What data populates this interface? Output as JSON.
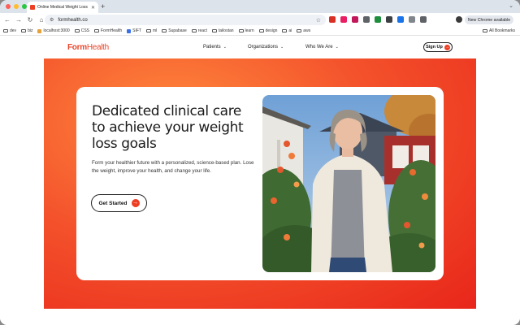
{
  "browser": {
    "tab_title": "Online Medical Weight Loss",
    "url": "formhealth.co",
    "profile_button": "New Chrome available",
    "bookmarks": [
      {
        "label": "dev",
        "type": "folder"
      },
      {
        "label": "biz",
        "type": "folder"
      },
      {
        "label": "localhost:3000",
        "type": "site",
        "color": "#e5a13a"
      },
      {
        "label": "CSS",
        "type": "folder"
      },
      {
        "label": "FormHealth",
        "type": "folder"
      },
      {
        "label": "SIFT",
        "type": "site",
        "color": "#3a6fe5"
      },
      {
        "label": "ml",
        "type": "folder"
      },
      {
        "label": "Supabase",
        "type": "folder"
      },
      {
        "label": "react",
        "type": "folder"
      },
      {
        "label": "tailostan",
        "type": "folder"
      },
      {
        "label": "learn",
        "type": "folder"
      },
      {
        "label": "design",
        "type": "folder"
      },
      {
        "label": "ai",
        "type": "folder"
      },
      {
        "label": "aws",
        "type": "folder"
      }
    ],
    "all_bookmarks": "All Bookmarks",
    "extensions": [
      {
        "name": "red-extension-icon",
        "color": "#d93025"
      },
      {
        "name": "pink-extension-icon",
        "color": "#e91e63"
      },
      {
        "name": "magenta-extension-icon",
        "color": "#c2185b"
      },
      {
        "name": "grid-extension-icon",
        "color": "#5f6368"
      },
      {
        "name": "green-extension-icon",
        "color": "#1e8e3e"
      },
      {
        "name": "dark-extension-icon",
        "color": "#3c4043"
      },
      {
        "name": "blue-extension-icon",
        "color": "#1a73e8"
      },
      {
        "name": "gray-extension-icon",
        "color": "#80868b"
      },
      {
        "name": "puzzle-extension-icon",
        "color": "#5f6368"
      }
    ]
  },
  "site": {
    "logo_bold": "Form",
    "logo_light": "Health",
    "nav": [
      {
        "label": "Patients"
      },
      {
        "label": "Organizations"
      },
      {
        "label": "Who We Are"
      }
    ],
    "signup_label": "Sign Up",
    "hero": {
      "headline": "Dedicated clinical care to achieve your weight loss goals",
      "subtext": "Form your healthier future with a personalized, science-based plan. Lose the weight, improve your health, and change your life.",
      "cta_label": "Get Started"
    },
    "colors": {
      "brand": "#ee3e23",
      "hero_gradient_inner": "#ff8a3d",
      "hero_gradient_outer": "#e8261a"
    }
  }
}
